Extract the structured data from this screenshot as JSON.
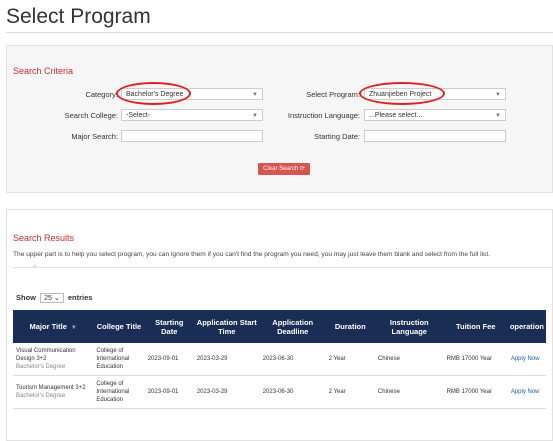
{
  "page": {
    "title": "Select Program"
  },
  "criteria": {
    "title": "Search Criteria",
    "category_label": "Category:",
    "category_value": "Bachelor's Degree",
    "program_label": "Select Program:",
    "program_value": "Zhuanjieben Project",
    "college_label": "Search College:",
    "college_value": "-Select-",
    "language_label": "Instruction Language:",
    "language_value": "...Please select...",
    "major_label": "Major Search:",
    "date_label": "Starting Date:",
    "clear_label": "Clear Search"
  },
  "results": {
    "title": "Search Results",
    "hint": "The upper part is to help you select program, you can ignore them if you can't find the program you need, you may just leave them blank and select from the full list.",
    "show_label": "Show",
    "entries_value": "25",
    "entries_label": "entries",
    "columns": [
      "Major Title",
      "College Title",
      "Starting Date",
      "Application Start Time",
      "Application Deadline",
      "Duration",
      "Instruction Language",
      "Tuition Fee",
      "operation"
    ],
    "rows": [
      {
        "major": "Visual Communication Design 3+2",
        "degree": "Bachelor's Degree",
        "college": "College of International Education",
        "start": "2023-09-01",
        "app_start": "2023-03-29",
        "deadline": "2023-06-30",
        "duration": "2 Year",
        "language": "Chinese",
        "fee": "RMB 17000 Year",
        "op": "Apply Now"
      },
      {
        "major": "Tourism Management 3+2",
        "degree": "Bachelor's Degree",
        "college": "College of International Education",
        "start": "2023-09-01",
        "app_start": "2023-03-29",
        "deadline": "2023-06-30",
        "duration": "2 Year",
        "language": "Chinese",
        "fee": "RMB 17000 Year",
        "op": "Apply Now"
      }
    ]
  },
  "colors": {
    "accent": "#c9302c",
    "header": "#1a2d55",
    "link": "#1f5fa8",
    "highlight": "#e02020"
  }
}
